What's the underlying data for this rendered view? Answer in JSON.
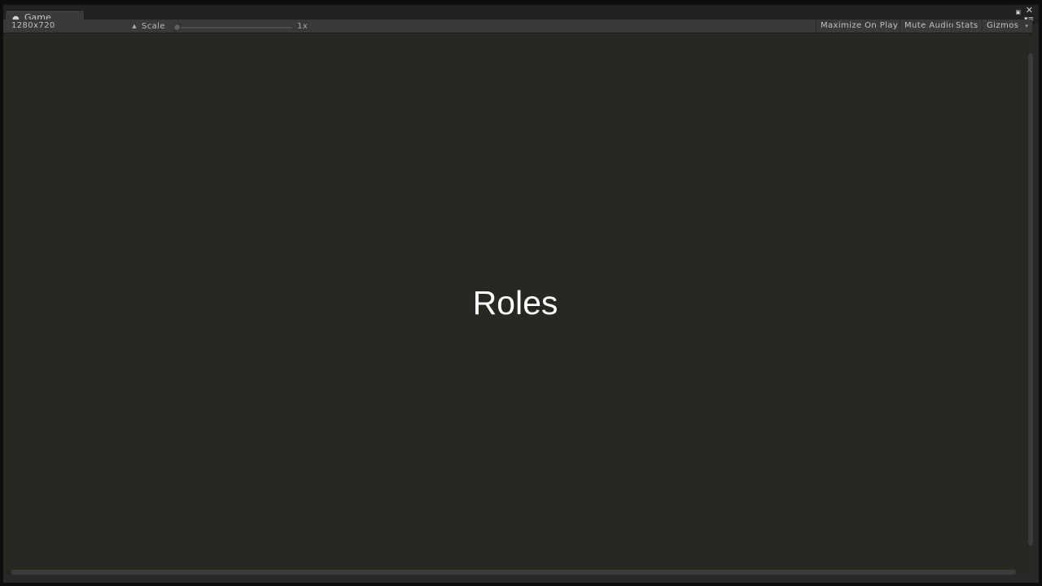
{
  "window": {
    "tab_label": "Game",
    "tab_icon": "pacman-game-icon"
  },
  "toolbar": {
    "resolution": "1280x720",
    "scale_label": "Scale",
    "scale_value": "1x",
    "scale_slider_level": 0,
    "maximize_on_play": "Maximize On Play",
    "mute_audio": "Mute Audio",
    "stats": "Stats",
    "gizmos": "Gizmos"
  },
  "game": {
    "title": "Roles",
    "background_color": "#272822",
    "text_color": "#ffffff"
  }
}
